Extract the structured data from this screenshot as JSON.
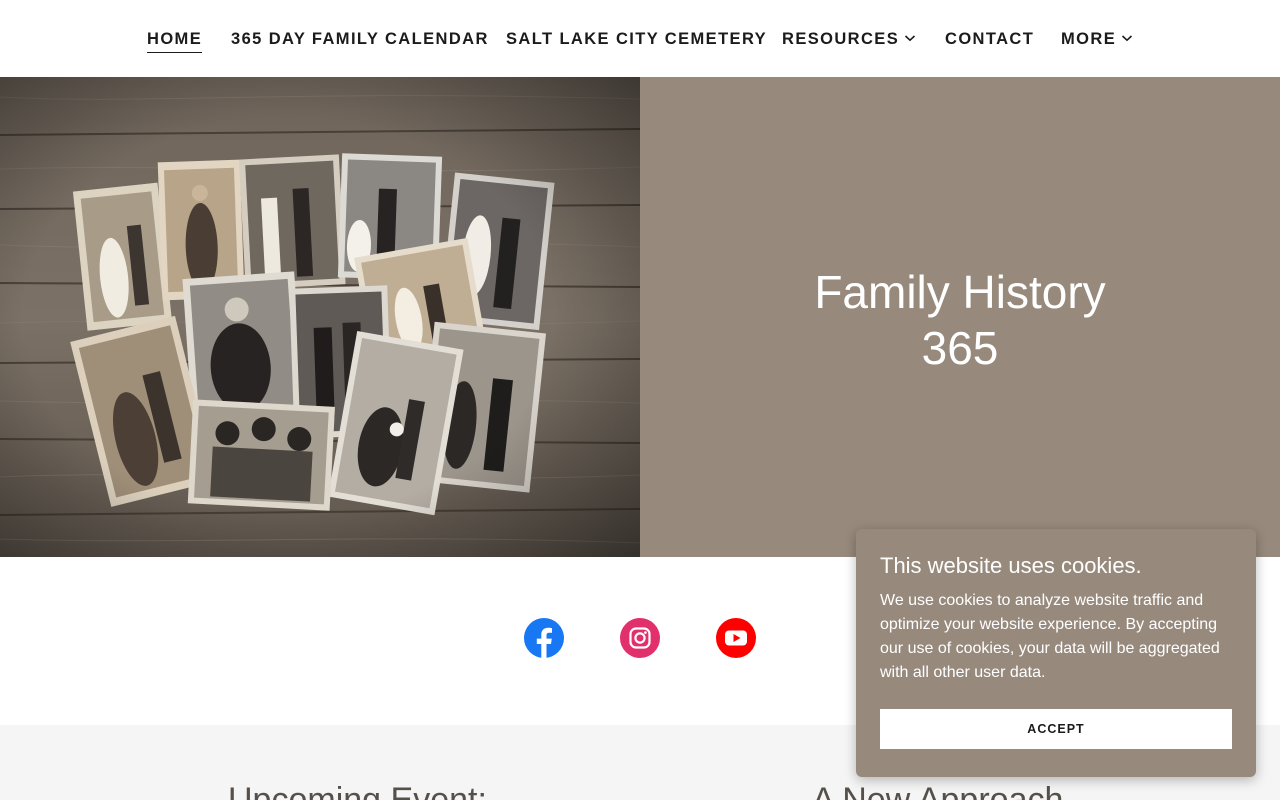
{
  "nav": {
    "items": [
      {
        "label": "HOME",
        "active": true
      },
      {
        "label": "365 DAY FAMILY CALENDAR"
      },
      {
        "label": "SALT LAKE CITY CEMETERY"
      },
      {
        "label": "RESOURCES",
        "icon": "chevron-down-icon"
      },
      {
        "label": "CONTACT"
      },
      {
        "label": "MORE",
        "icon": "chevron-down-icon"
      }
    ]
  },
  "hero": {
    "title_line1": "Family History",
    "title_line2": "365",
    "panel_color": "#978a7d"
  },
  "social": [
    {
      "name": "facebook-icon",
      "color": "#1877f2"
    },
    {
      "name": "instagram-icon",
      "color": "#e1306c"
    },
    {
      "name": "youtube-icon",
      "color": "#ff0000"
    }
  ],
  "lower": {
    "left_heading": "Upcoming Event:",
    "right_heading": "A New Approach"
  },
  "cookie": {
    "title": "This website uses cookies.",
    "body": "We use cookies to analyze website traffic and optimize your website experience. By accepting our use of cookies, your data will be aggregated with all other user data.",
    "accept_label": "ACCEPT"
  }
}
